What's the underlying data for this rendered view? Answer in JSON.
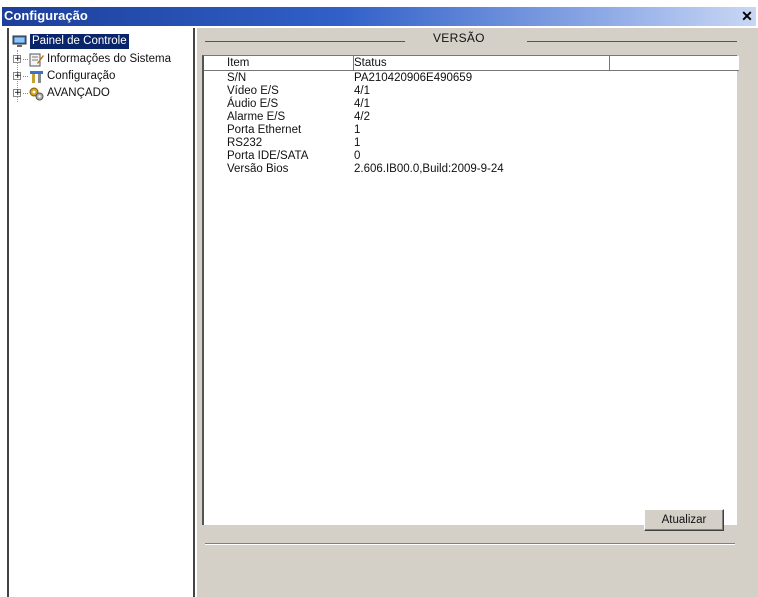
{
  "window": {
    "title": "Configuração",
    "close_glyph": "✕"
  },
  "sidebar": {
    "root_label": "Painel de Controle",
    "items": [
      {
        "label": "Informações do Sistema",
        "icon": "info-icon"
      },
      {
        "label": "Configuração",
        "icon": "tools-icon"
      },
      {
        "label": "AVANÇADO",
        "icon": "gears-icon"
      }
    ]
  },
  "main": {
    "section_title": "VERSÃO",
    "columns": [
      "Item",
      "Status"
    ],
    "rows": [
      [
        "S/N",
        "PA210420906E490659"
      ],
      [
        "Vídeo E/S",
        "4/1"
      ],
      [
        "Áudio E/S",
        "4/1"
      ],
      [
        "Alarme E/S",
        "4/2"
      ],
      [
        "Porta Ethernet",
        "1"
      ],
      [
        "RS232",
        "1"
      ],
      [
        "Porta IDE/SATA",
        "0"
      ],
      [
        "Versão Bios",
        "2.606.IB00.0,Build:2009-9-24"
      ]
    ],
    "refresh_button": "Atualizar"
  }
}
